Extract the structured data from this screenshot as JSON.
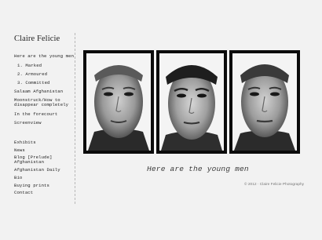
{
  "site": {
    "title": "Claire Felicie"
  },
  "nav": {
    "series_items": [
      "Here are the young men",
      "1. Marked",
      "2. Armoured",
      "3. Committed",
      "Salaam Afghanistan",
      "Moonstruck/How to",
      "disappear completely",
      "In the forecourt",
      "Screenview"
    ],
    "page_items": [
      "Exhibits",
      "News",
      "Blog [Prelude]",
      "Afghanistan",
      "Afghanistan Daily",
      "Bio",
      "Buying prints",
      "Contact"
    ]
  },
  "gallery": {
    "caption": "Here are the young men",
    "photos": [
      "portrait-1",
      "portrait-2",
      "portrait-3"
    ]
  },
  "footer": {
    "copyright": "© 2012 · Claire Felicie Photography"
  },
  "colors": {
    "background": "#f2f2f2",
    "text": "#222222",
    "photo_border": "#0b0b0b"
  }
}
